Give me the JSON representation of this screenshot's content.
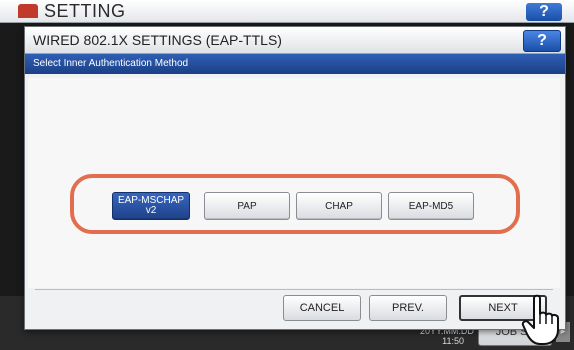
{
  "background": {
    "title": "SETTING",
    "help_label": "?",
    "clock": [
      "20YY.MM.DD",
      "11:50"
    ],
    "job_status_label": "JOB ST",
    "arrow": "▸"
  },
  "dialog": {
    "title": "WIRED 802.1X SETTINGS (EAP-TTLS)",
    "help_label": "?",
    "subtitle": "Select Inner Authentication Method",
    "options": [
      {
        "label": "EAP-MSCHAP v2",
        "selected": true
      },
      {
        "label": "PAP",
        "selected": false
      },
      {
        "label": "CHAP",
        "selected": false
      },
      {
        "label": "EAP-MD5",
        "selected": false
      }
    ],
    "buttons": {
      "cancel": "CANCEL",
      "prev": "PREV.",
      "next": "NEXT"
    }
  },
  "colors": {
    "accent_blue": "#1f428a",
    "highlight_ring": "#e26e4e"
  },
  "icons": {
    "pointer": "hand-pointer-icon"
  }
}
